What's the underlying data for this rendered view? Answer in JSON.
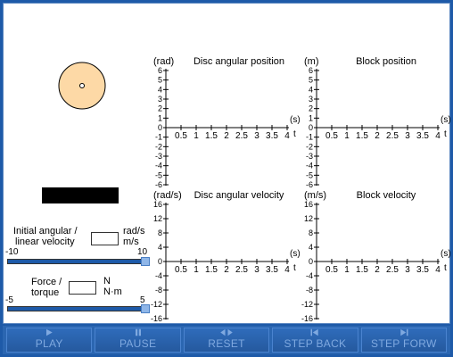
{
  "controls": {
    "velocity_label_1": "Initial angular /",
    "velocity_label_2": "linear velocity",
    "velocity_unit_1": "rad/s",
    "velocity_unit_2": "m/s",
    "velocity_slider": {
      "min_label": "-10",
      "max_label": "10",
      "min": -10,
      "max": 10,
      "value": 10
    },
    "force_label_1": "Force /",
    "force_label_2": "torque",
    "force_unit_1": "N",
    "force_unit_2": "N·m",
    "force_slider": {
      "min_label": "-5",
      "max_label": "5",
      "min": -5,
      "max": 5,
      "value": 5
    }
  },
  "toolbar": {
    "play": "PLAY",
    "pause": "PAUSE",
    "reset": "RESET",
    "step_back": "STEP BACK",
    "step_forward": "STEP FORW"
  },
  "icons": [
    "play-icon",
    "pause-icon",
    "reset-icon",
    "step-back-icon",
    "step-forward-icon"
  ],
  "colors": {
    "background": "#1e5aa8",
    "disc_fill": "#fdd9a6",
    "button_text": "#7fa9e0"
  },
  "chart_data": [
    {
      "type": "line",
      "title": "Disc angular position",
      "ylabel": "(rad)",
      "xlabel": "t",
      "xunit": "(s)",
      "xlim": [
        0,
        4
      ],
      "ylim": [
        -6,
        6
      ],
      "xticks": [
        "0.5",
        "1",
        "1.5",
        "2",
        "2.5",
        "3",
        "3.5",
        "4"
      ],
      "yticks": [
        "6",
        "5",
        "4",
        "3",
        "2",
        "1",
        "0",
        "-1",
        "-2",
        "-3",
        "-4",
        "-5",
        "-6"
      ],
      "series": []
    },
    {
      "type": "line",
      "title": "Block position",
      "ylabel": "(m)",
      "xlabel": "t",
      "xunit": "(s)",
      "xlim": [
        0,
        4
      ],
      "ylim": [
        -6,
        6
      ],
      "xticks": [
        "0.5",
        "1",
        "1.5",
        "2",
        "2.5",
        "3",
        "3.5",
        "4"
      ],
      "yticks": [
        "6",
        "5",
        "4",
        "3",
        "2",
        "1",
        "0",
        "-1",
        "-2",
        "-3",
        "-4",
        "-5",
        "-6"
      ],
      "series": []
    },
    {
      "type": "line",
      "title": "Disc angular velocity",
      "ylabel": "(rad/s)",
      "xlabel": "t",
      "xunit": "(s)",
      "xlim": [
        0,
        4
      ],
      "ylim": [
        -16,
        16
      ],
      "xticks": [
        "0.5",
        "1",
        "1.5",
        "2",
        "2.5",
        "3",
        "3.5",
        "4"
      ],
      "yticks": [
        "16",
        "12",
        "8",
        "4",
        "0",
        "-4",
        "-8",
        "-12",
        "-16"
      ],
      "series": []
    },
    {
      "type": "line",
      "title": "Block velocity",
      "ylabel": "(m/s)",
      "xlabel": "t",
      "xunit": "(s)",
      "xlim": [
        0,
        4
      ],
      "ylim": [
        -16,
        16
      ],
      "xticks": [
        "0.5",
        "1",
        "1.5",
        "2",
        "2.5",
        "3",
        "3.5",
        "4"
      ],
      "yticks": [
        "16",
        "12",
        "8",
        "4",
        "0",
        "-4",
        "-8",
        "-12",
        "-16"
      ],
      "series": []
    }
  ]
}
